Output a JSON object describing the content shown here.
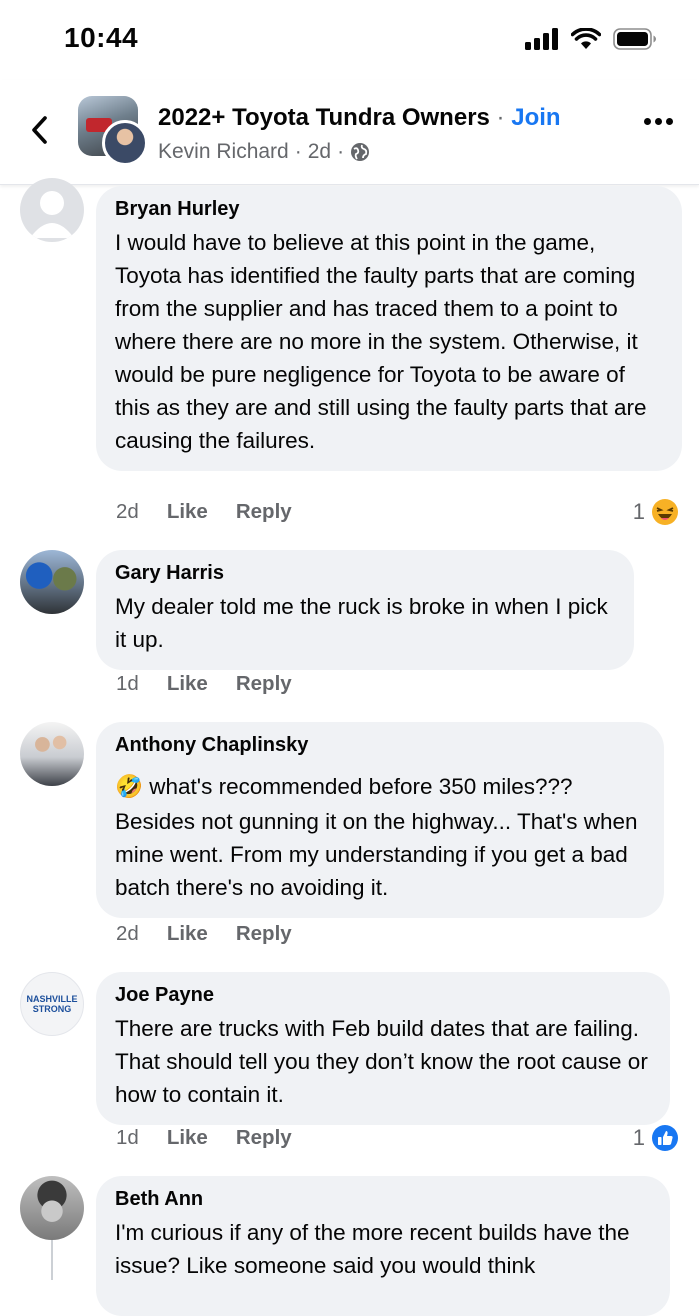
{
  "status_bar": {
    "time": "10:44",
    "icons": [
      "signal-icon",
      "wifi-icon",
      "battery-icon"
    ]
  },
  "header": {
    "group_name": "2022+ Toyota Tundra Owners",
    "separator": "·",
    "join_label": "Join",
    "author": "Kevin Richard",
    "time": "2d",
    "audience_icon": "globe-icon"
  },
  "comments": [
    {
      "name": "Bryan Hurley",
      "text": "I would have to believe at this point in the game, Toyota has identified the faulty parts that are coming from the supplier and has traced them to a point to where there are no more in the system. Otherwise, it would be pure negligence for Toyota to be aware of this as they are and still using the faulty parts that are causing the failures.",
      "time": "2d",
      "like": "Like",
      "reply": "Reply",
      "reaction_count": "1",
      "reaction_icon": "laugh-emoji-icon"
    },
    {
      "name": "Gary Harris",
      "text": "My dealer told me the ruck is broke in when I pick it up.",
      "time": "1d",
      "like": "Like",
      "reply": "Reply"
    },
    {
      "name": "Anthony Chaplinsky",
      "emoji": "🤣",
      "text_line1": "what's recommended before 350 miles???",
      "text": "Besides not gunning it on the highway... That's when mine went. From my understanding if you get a bad batch there's no avoiding it.",
      "time": "2d",
      "like": "Like",
      "reply": "Reply"
    },
    {
      "name": "Joe Payne",
      "avatar_text": "NASHVILLE STRONG",
      "text": "There are trucks with Feb build dates that are failing.  That should tell you they don’t know the root cause or how to contain it.",
      "time": "1d",
      "like": "Like",
      "reply": "Reply",
      "reaction_count": "1",
      "reaction_icon": "like-thumb-icon"
    },
    {
      "name": "Beth Ann",
      "text": "I'm curious if any of the more recent builds have the issue? Like someone said you would think"
    }
  ],
  "colors": {
    "accent": "#1877f2",
    "bubble": "#f0f2f5",
    "meta": "#65676b",
    "text": "#050505"
  }
}
